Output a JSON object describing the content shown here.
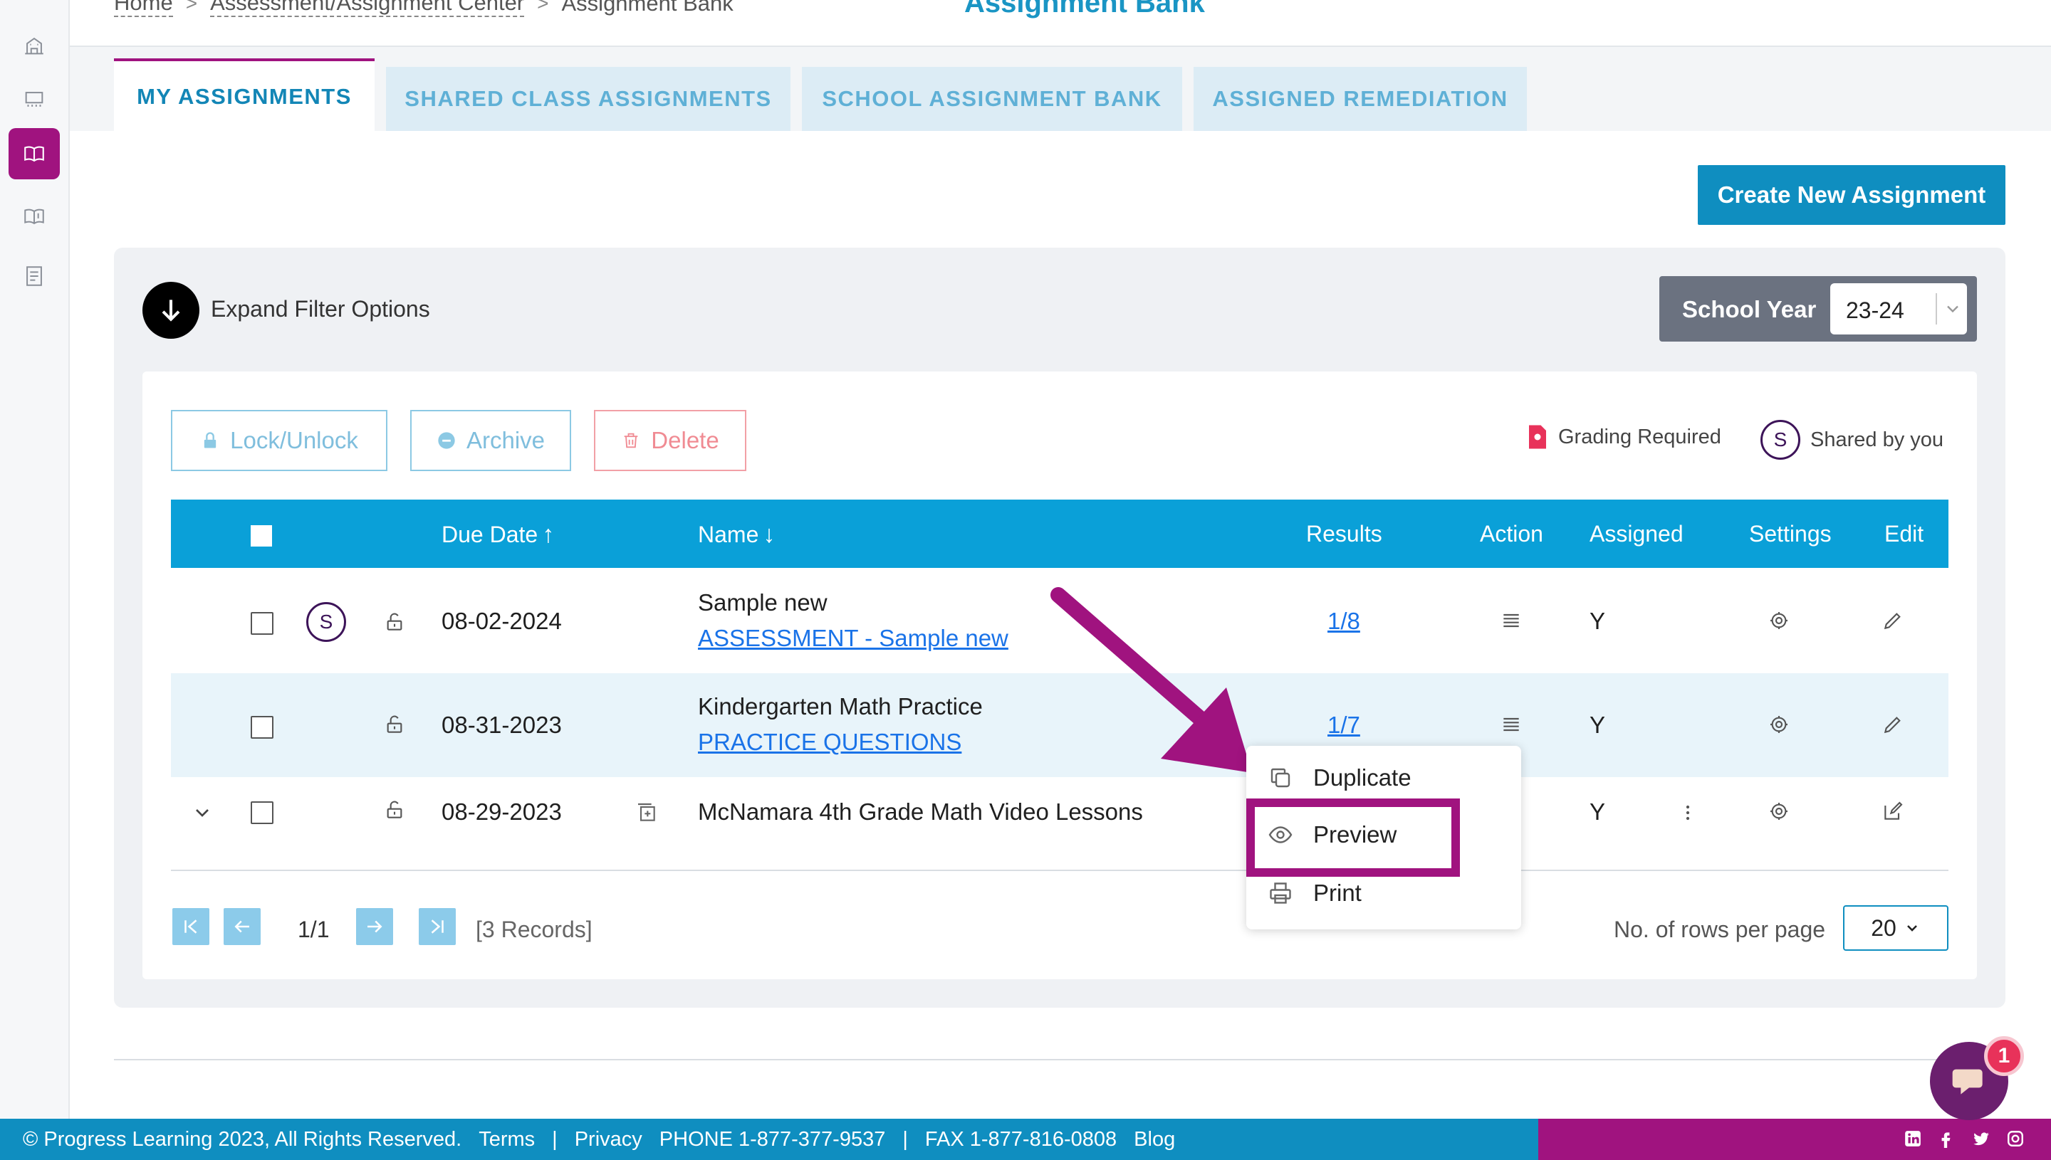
{
  "breadcrumb": {
    "home": "Home",
    "center": "Assessment/Assignment Center",
    "current": "Assignment Bank",
    "sep": ">"
  },
  "page_title": "Assignment Bank",
  "tabs": [
    {
      "label": "MY ASSIGNMENTS",
      "active": true
    },
    {
      "label": "SHARED CLASS ASSIGNMENTS",
      "active": false
    },
    {
      "label": "SCHOOL ASSIGNMENT BANK",
      "active": false
    },
    {
      "label": "ASSIGNED REMEDIATION",
      "active": false
    }
  ],
  "create_button": "Create New Assignment",
  "filter": {
    "expand_label": "Expand Filter Options"
  },
  "school_year": {
    "label": "School Year",
    "value": "23-24"
  },
  "actions": {
    "lock": "Lock/Unlock",
    "archive": "Archive",
    "delete": "Delete"
  },
  "legend": {
    "grading": "Grading Required",
    "shared_badge": "S",
    "shared": "Shared by you"
  },
  "table": {
    "columns": {
      "due_date": "Due Date",
      "name": "Name",
      "results": "Results",
      "action": "Action",
      "assigned": "Assigned",
      "settings": "Settings",
      "edit": "Edit"
    },
    "sort_up": "↑",
    "sort_down": "↓",
    "rows": [
      {
        "shared_badge": "S",
        "due": "08-02-2024",
        "name": "Sample new",
        "sub_link": "ASSESSMENT - Sample new",
        "results": "1/8",
        "assigned": "Y"
      },
      {
        "due": "08-31-2023",
        "name": "Kindergarten Math Practice",
        "sub_link": "PRACTICE QUESTIONS",
        "results": "1/7",
        "assigned": "Y"
      },
      {
        "due": "08-29-2023",
        "name": "McNamara 4th Grade Math Video Lessons",
        "assigned": "Y"
      }
    ]
  },
  "context_menu": {
    "duplicate": "Duplicate",
    "preview": "Preview",
    "print": "Print"
  },
  "pagination": {
    "page": "1/1",
    "records": "[3 Records]",
    "rows_label": "No. of rows per page",
    "rows_value": "20"
  },
  "footer": {
    "copyright": "© Progress Learning 2023, All Rights Reserved.",
    "terms": "Terms",
    "sep": "|",
    "privacy": "Privacy",
    "phone": "PHONE 1-877-377-9537",
    "fax": "FAX 1-877-816-0808",
    "blog": "Blog"
  },
  "chat_badge": "1",
  "colors": {
    "brand_blue": "#0f8ec0",
    "table_header": "#0aa0d8",
    "accent_magenta": "#a0137f"
  }
}
